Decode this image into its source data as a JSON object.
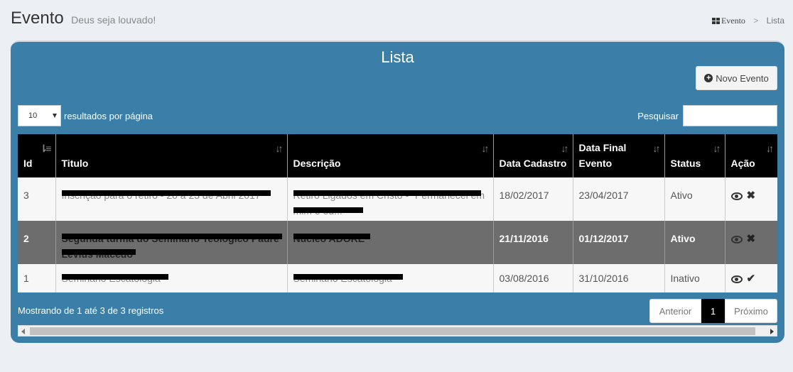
{
  "header": {
    "title": "Evento",
    "subtitle": "Deus seja louvado!"
  },
  "breadcrumb": {
    "icon": "grid-icon",
    "item1": "Evento",
    "separator": ">",
    "item2": "Lista"
  },
  "panel": {
    "title": "Lista",
    "new_button": "Novo Evento",
    "new_button_icon": "plus-circle-icon"
  },
  "length": {
    "value": "10",
    "label": "resultados por página"
  },
  "search": {
    "label": "Pesquisar",
    "value": ""
  },
  "table": {
    "headers": [
      "Id",
      "Titulo",
      "Descrição",
      "Data Cadastro",
      "Data Final Evento",
      "Status",
      "Ação"
    ],
    "rows": [
      {
        "id": "3",
        "titulo": "Inscrição para o retiro - 20 a 23 de Abril 2017",
        "descricao": "Retiro Ligados em Cristo - \"Permanecei em mim e eu...",
        "data_cadastro": "18/02/2017",
        "data_final": "23/04/2017",
        "status": "Ativo",
        "action_icon": "close-icon"
      },
      {
        "id": "2",
        "titulo": "Segunda turma do Seminário Teológico Padre Lévius Macedo",
        "descricao": "Núcleo ADORE",
        "data_cadastro": "21/11/2016",
        "data_final": "01/12/2017",
        "status": "Ativo",
        "action_icon": "close-icon"
      },
      {
        "id": "1",
        "titulo": "Seminário Escatologia",
        "descricao": "Seminário Escatologia",
        "data_cadastro": "03/08/2016",
        "data_final": "31/10/2016",
        "status": "Inativo",
        "action_icon": "check-icon"
      }
    ]
  },
  "footer": {
    "info": "Mostrando de 1 até 3 de 3 registros",
    "prev": "Anterior",
    "page": "1",
    "next": "Próximo"
  }
}
